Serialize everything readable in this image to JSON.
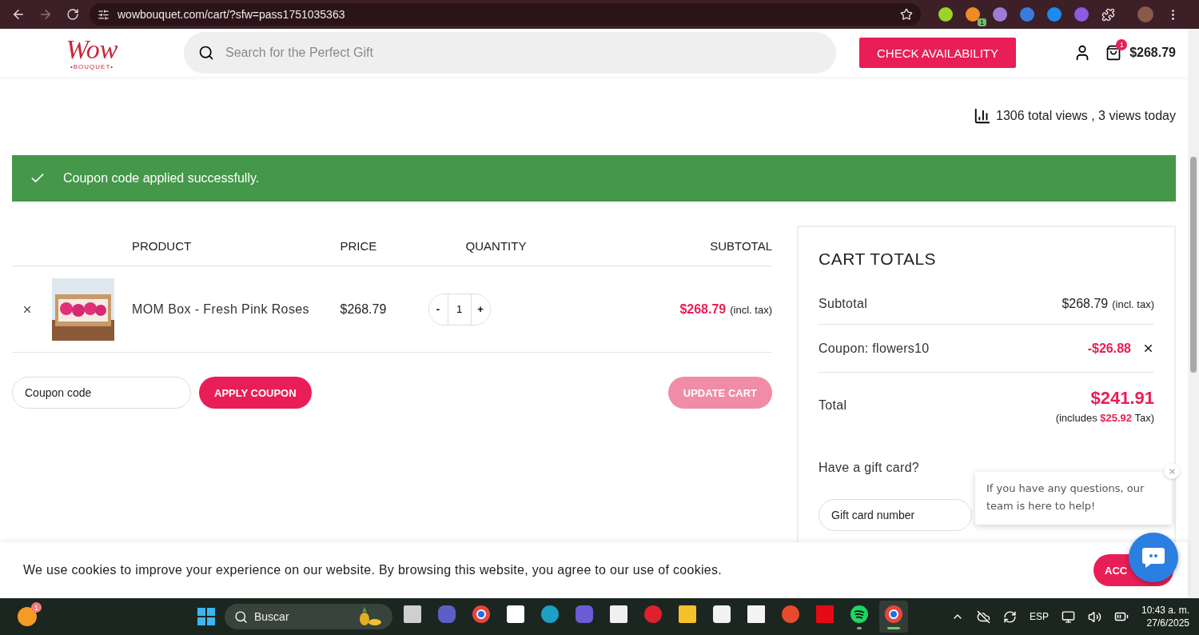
{
  "browser": {
    "url": "wowbouquet.com/cart/?sfw=pass1751035363",
    "extension_badge": "1"
  },
  "header": {
    "logo": {
      "script": "Wow",
      "tagline": "•BOUQUET•"
    },
    "search": {
      "placeholder": "Search for the Perfect Gift"
    },
    "check_button": "CHECK AVAILABILITY",
    "cart_count": "1",
    "cart_total": "$268.79"
  },
  "views": "1306 total views , 3 views today",
  "notice": "Coupon code applied successfully.",
  "cart": {
    "columns": [
      "PRODUCT",
      "PRICE",
      "QUANTITY",
      "SUBTOTAL"
    ],
    "rows": [
      {
        "kind": "picture",
        "name": "MOM Box - Fresh Pink Roses",
        "price": "$268.79",
        "minus": "-",
        "quantity": "1",
        "plus": "+",
        "subtotal": "$268.79",
        "subtotal_note": "(incl. tax)"
      }
    ],
    "coupon": {
      "placeholder": "Coupon code",
      "apply": "APPLY COUPON"
    },
    "update": {
      "label": "UPDATE CART",
      "disabled": true
    }
  },
  "totals": {
    "title": "CART TOTALS",
    "subtotal": {
      "label": "Subtotal",
      "value": "$268.79",
      "note": "(incl. tax)"
    },
    "coupon": {
      "label": "Coupon: flowers10",
      "value": "-$26.88"
    },
    "total": {
      "label": "Total",
      "value": "$241.91",
      "tax_prefix": "(includes",
      "tax_amount": "$25.92",
      "tax_suffix": "Tax)"
    },
    "gift": {
      "question": "Have a gift card?",
      "placeholder": "Gift card number"
    }
  },
  "chat": {
    "message": "If you have any questions, our team is here to help!"
  },
  "cookie": {
    "text": "We use cookies to improve your experience on our website. By browsing this website, you agree to our use of cookies.",
    "accept": "ACC"
  },
  "taskbar": {
    "weather_badge": "1",
    "search": "Buscar",
    "apps": [
      {
        "kind": "taskview",
        "running": false,
        "active": false
      },
      {
        "kind": "teams",
        "running": false,
        "active": false
      },
      {
        "kind": "chrome",
        "running": false,
        "active": false
      },
      {
        "kind": "notion",
        "running": false,
        "active": false
      },
      {
        "kind": "edge",
        "running": false,
        "active": false
      },
      {
        "kind": "copilot",
        "running": false,
        "active": false
      },
      {
        "kind": "amazon",
        "running": false,
        "active": false
      },
      {
        "kind": "opera",
        "running": false,
        "active": false
      },
      {
        "kind": "folder",
        "running": false,
        "active": false
      },
      {
        "kind": "store",
        "running": false,
        "active": false
      },
      {
        "kind": "document",
        "running": false,
        "active": false
      },
      {
        "kind": "wps",
        "running": false,
        "active": false
      },
      {
        "kind": "netflix",
        "running": false,
        "active": false
      },
      {
        "kind": "spotify",
        "running": true,
        "active": false
      },
      {
        "kind": "chrome",
        "running": true,
        "active": true
      }
    ],
    "language": "ESP",
    "time": "10:43 a. m.",
    "date": "27/6/2025"
  }
}
